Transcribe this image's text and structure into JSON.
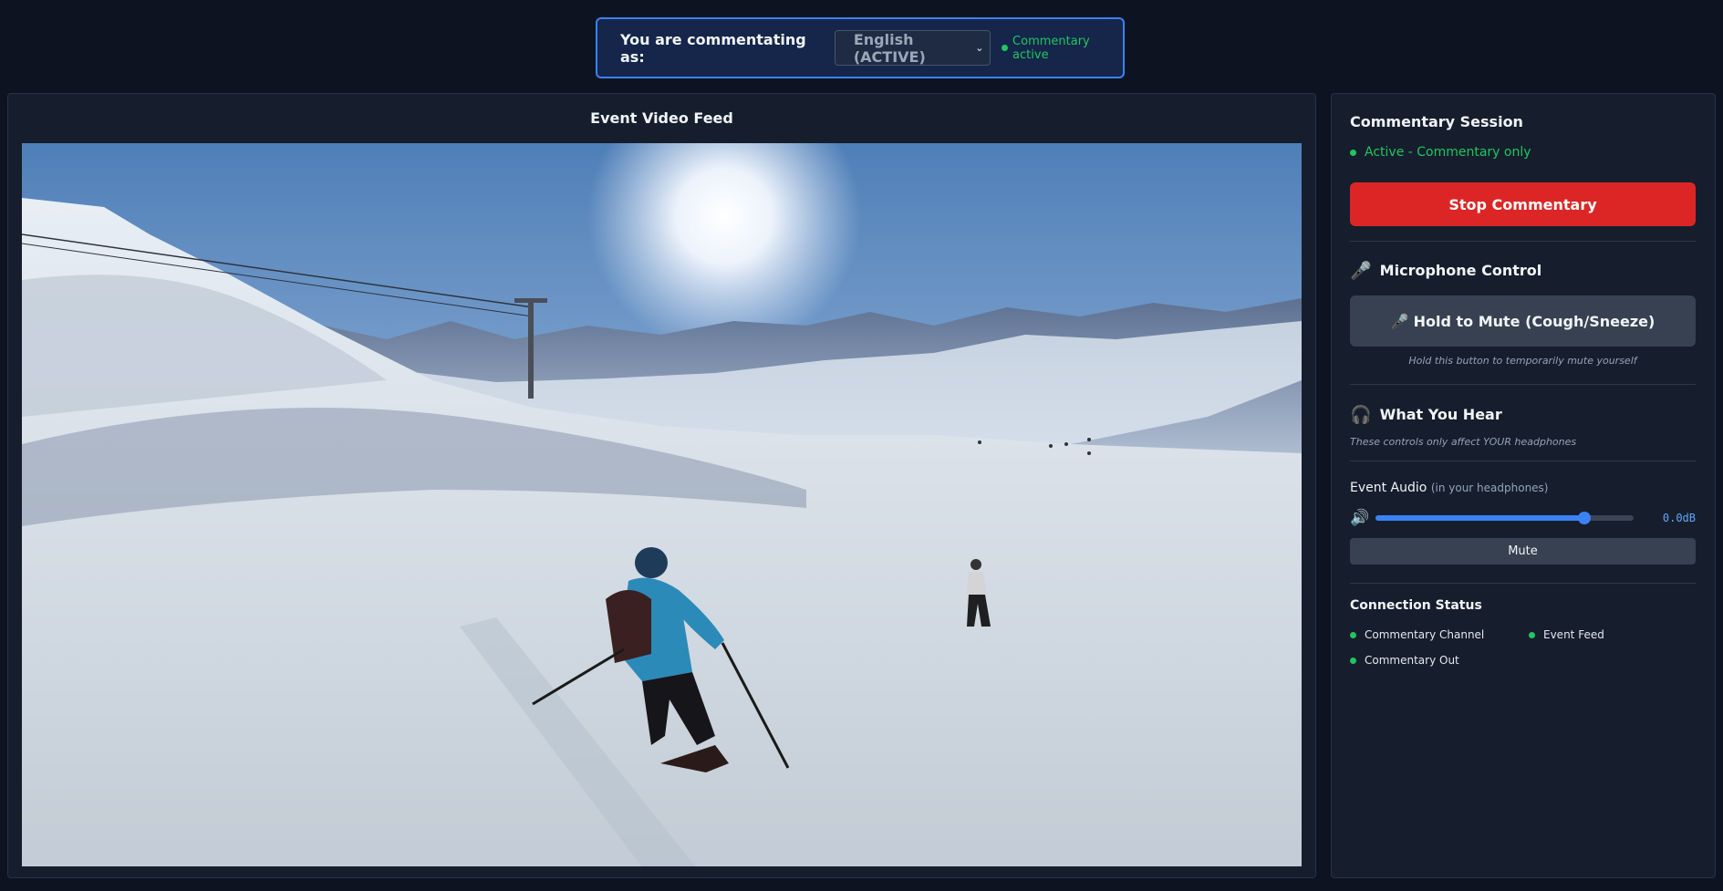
{
  "language_bar": {
    "label": "You are commentating as:",
    "selected_language": "English (ACTIVE)",
    "status": "Commentary active",
    "status_color": "#22c55e"
  },
  "video": {
    "title": "Event Video Feed"
  },
  "session": {
    "title": "Commentary Session",
    "status": "Active - Commentary only",
    "stop_label": "Stop Commentary",
    "stop_color": "#dc2626"
  },
  "microphone": {
    "icon": "microphone-icon",
    "title": "Microphone Control",
    "mute_label": "Hold to Mute (Cough/Sneeze)",
    "hint": "Hold this button to temporarily mute yourself"
  },
  "hear": {
    "icon": "headphones-icon",
    "title": "What You Hear",
    "hint": "These controls only affect YOUR headphones",
    "event_audio_label": "Event Audio",
    "event_audio_sub": "(in your headphones)",
    "volume_fraction": 0.81,
    "volume_readout": "0.0dB",
    "mute_label": "Mute",
    "accent": "#3b82f6"
  },
  "connection": {
    "title": "Connection Status",
    "items": [
      {
        "label": "Commentary Channel",
        "status": "connected"
      },
      {
        "label": "Event Feed",
        "status": "connected"
      },
      {
        "label": "Commentary Out",
        "status": "connected"
      }
    ]
  }
}
